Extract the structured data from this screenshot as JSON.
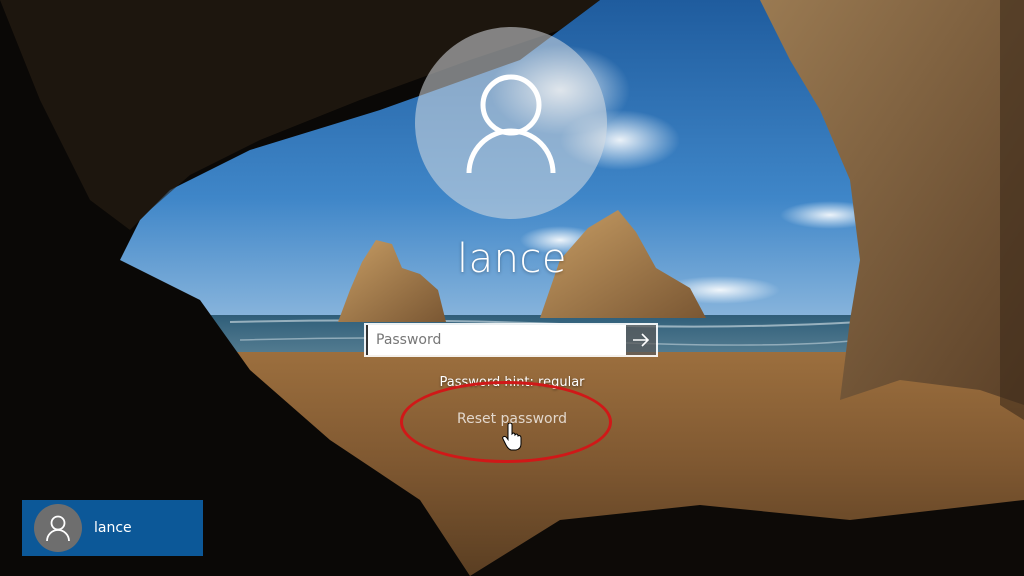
{
  "user": {
    "name": "lance"
  },
  "password": {
    "placeholder": "Password",
    "value": "",
    "hint": "Password hint: regular"
  },
  "links": {
    "reset_password": "Reset password"
  },
  "user_tiles": [
    {
      "name": "lance",
      "selected": true
    }
  ],
  "colors": {
    "tile_bg": "#0c5898",
    "annotation": "#d01818"
  },
  "icons": {
    "user_large": "user-icon",
    "user_small": "user-icon",
    "submit": "arrow-right-icon",
    "pointer": "hand-cursor-icon"
  }
}
